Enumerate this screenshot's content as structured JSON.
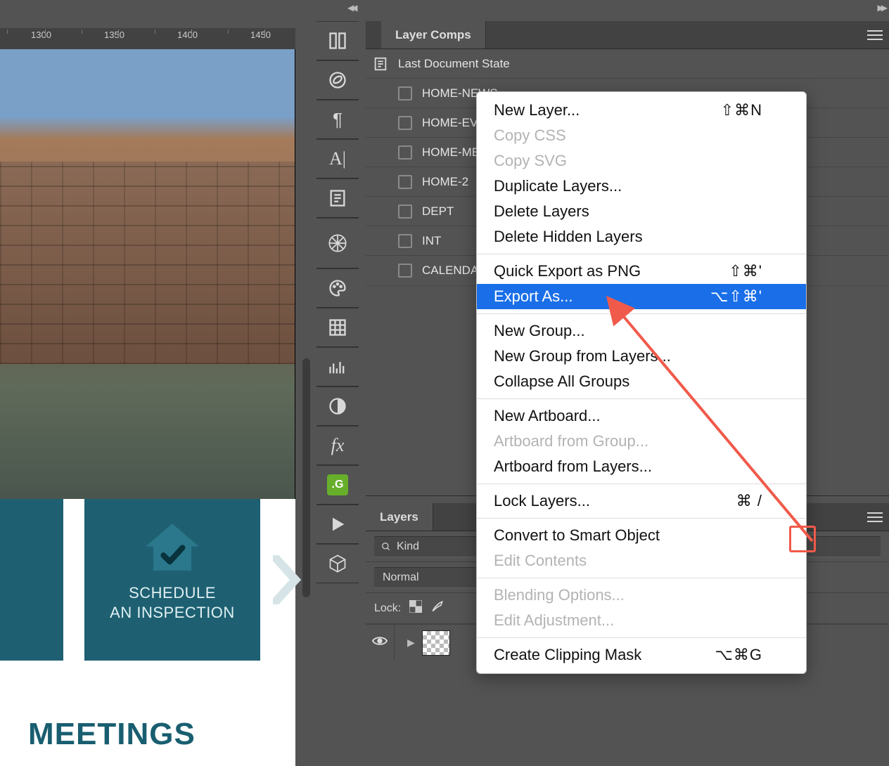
{
  "ruler": {
    "marks": [
      "1300",
      "1350",
      "1400",
      "1450"
    ]
  },
  "canvas": {
    "tile_line1": "SCHEDULE",
    "tile_line2": "AN INSPECTION",
    "heading_partial": "MEETINGS"
  },
  "layer_comps": {
    "tab": "Layer Comps",
    "root": "Last Document State",
    "items": [
      "HOME-NEWS",
      "HOME-EV",
      "HOME-ME",
      "HOME-2",
      "DEPT",
      "INT",
      "CALENDAR"
    ]
  },
  "layers": {
    "tab": "Layers",
    "filter_label": "Kind",
    "blend_mode": "Normal",
    "lock_label": "Lock:"
  },
  "context_menu": {
    "items": [
      {
        "label": "New Layer...",
        "shortcut": "⇧⌘N"
      },
      {
        "label": "Copy CSS",
        "disabled": true
      },
      {
        "label": "Copy SVG",
        "disabled": true
      },
      {
        "label": "Duplicate Layers..."
      },
      {
        "label": "Delete Layers"
      },
      {
        "label": "Delete Hidden Layers",
        "divider_after": true
      },
      {
        "label": "Quick Export as PNG",
        "shortcut": "⇧⌘'"
      },
      {
        "label": "Export As...",
        "shortcut": "⌥⇧⌘'",
        "selected": true,
        "divider_after": true
      },
      {
        "label": "New Group..."
      },
      {
        "label": "New Group from Layers..."
      },
      {
        "label": "Collapse All Groups",
        "divider_after": true
      },
      {
        "label": "New Artboard..."
      },
      {
        "label": "Artboard from Group...",
        "disabled": true
      },
      {
        "label": "Artboard from Layers...",
        "divider_after": true
      },
      {
        "label": "Lock Layers...",
        "shortcut": "⌘ /",
        "divider_after": true
      },
      {
        "label": "Convert to Smart Object"
      },
      {
        "label": "Edit Contents",
        "disabled": true,
        "divider_after": true
      },
      {
        "label": "Blending Options...",
        "disabled": true
      },
      {
        "label": "Edit Adjustment...",
        "disabled": true,
        "divider_after": true
      },
      {
        "label": "Create Clipping Mask",
        "shortcut": "⌥⌘G"
      }
    ]
  },
  "toolstrip_icons": [
    "libraries-icon",
    "cc-icon",
    "paragraph-icon",
    "character-icon",
    "notes-icon",
    "navigator-icon",
    "palette-icon",
    "grid-icon",
    "histogram-icon",
    "contrast-icon",
    "fx-icon",
    "plugin-icon",
    "play-icon",
    "3d-icon"
  ]
}
